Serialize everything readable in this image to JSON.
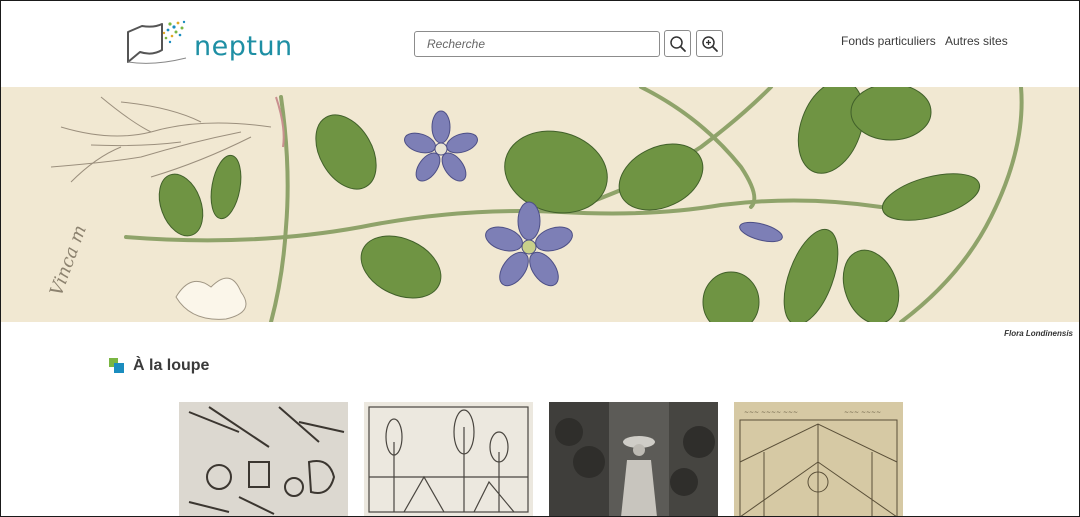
{
  "header": {
    "logo_text": "neptun",
    "search_placeholder": "Recherche",
    "nav": [
      "Fonds particuliers",
      "Autres sites"
    ]
  },
  "hero": {
    "caption": "Flora Londinensis"
  },
  "section": {
    "title": "À la loupe"
  },
  "colors": {
    "brand": "#1e8fa4",
    "section_mark_green": "#7ab642",
    "section_mark_blue": "#1b8dbf",
    "hero_bg": "#f1e8d2"
  }
}
